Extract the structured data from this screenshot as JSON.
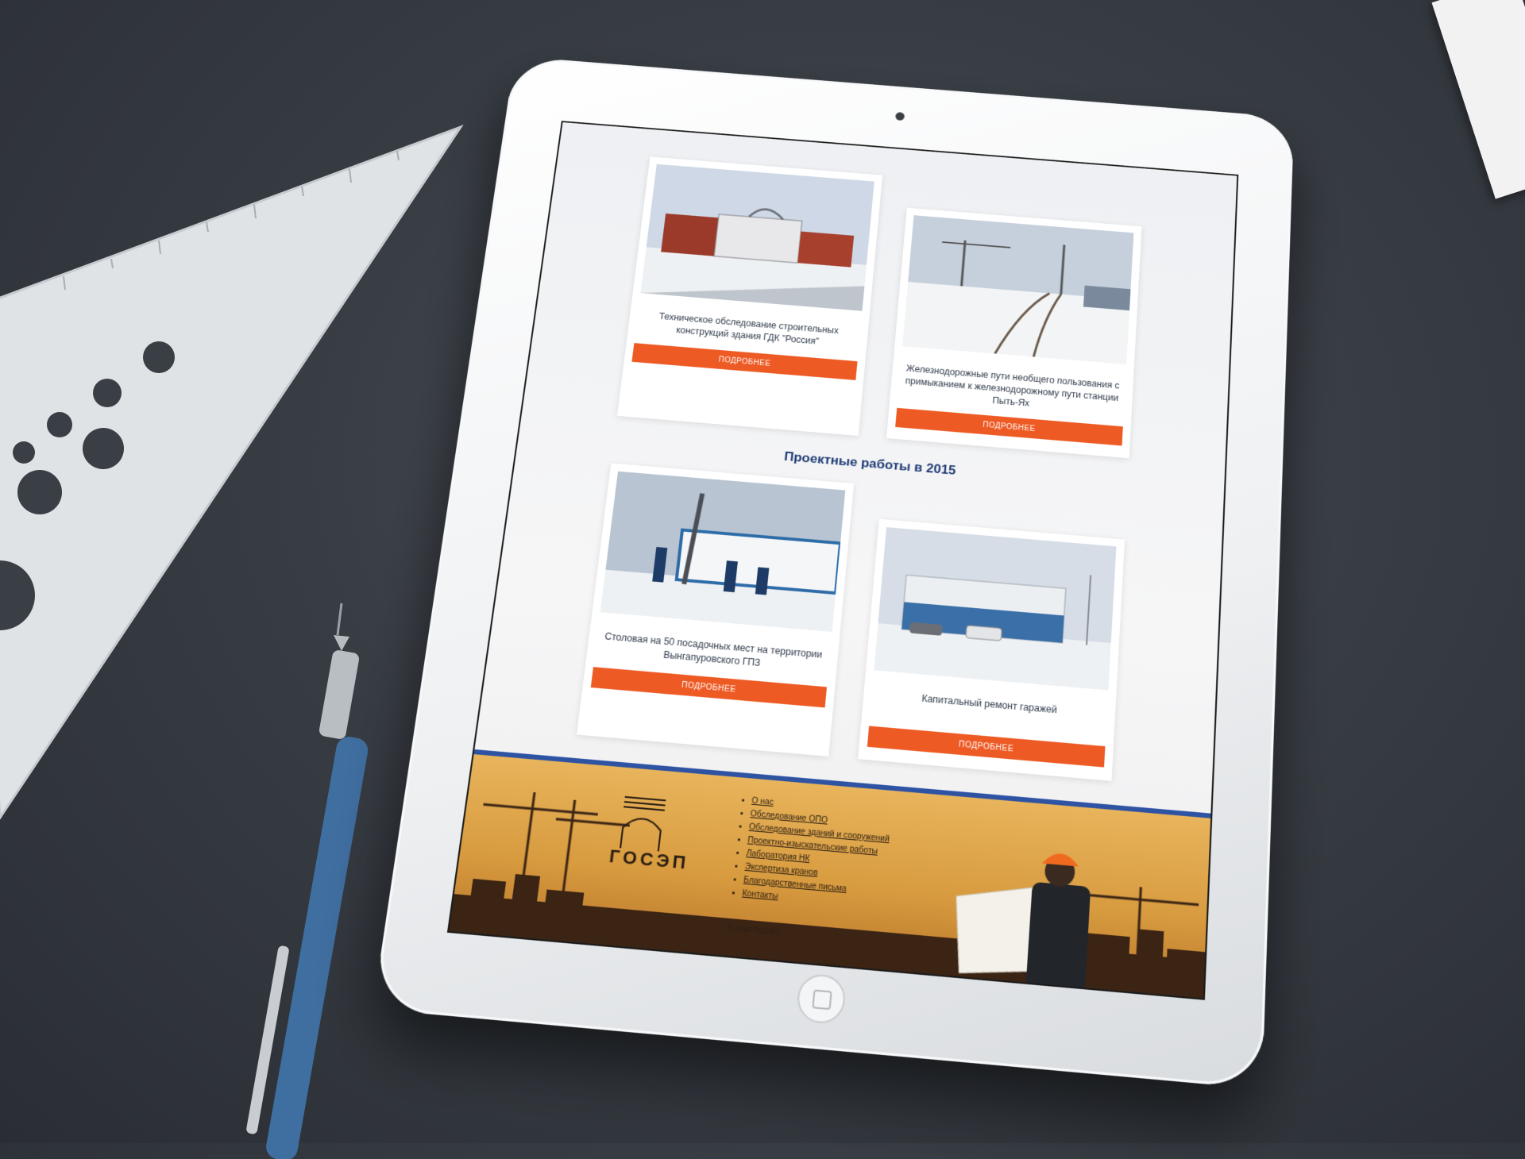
{
  "colors": {
    "accent": "#ee5a24",
    "title_blue": "#1f3b73",
    "footer_border": "#2f53a3",
    "footer_bg": "#d89b3f"
  },
  "cards_top": [
    {
      "caption": "Техническое обследование строительных конструкций здания ГДК \"Россия\"",
      "button": "подробнее"
    },
    {
      "caption": "Железнодорожные пути необщего пользования с примыканием к железнодорожному пути станции Пыть-Ях",
      "button": "подробнее"
    }
  ],
  "section_title": "Проектные работы в 2015",
  "cards_bottom": [
    {
      "caption": "Столовая на 50 посадочных мест на территории Вынгапуровского ГПЗ",
      "button": "подробнее"
    },
    {
      "caption": "Капитальный ремонт гаражей",
      "button": "подробнее"
    }
  ],
  "footer": {
    "logo_text": "ГОСЭП",
    "nav": [
      "О нас",
      "Обследование ОПО",
      "Обследование зданий и сооружений",
      "Проектно-изыскательские работы",
      "Лаборатория НК",
      "Экспертиза кранов",
      "Благодарственные письма",
      "Контакты"
    ],
    "copyright": "© 2015 ГОСЭП"
  }
}
